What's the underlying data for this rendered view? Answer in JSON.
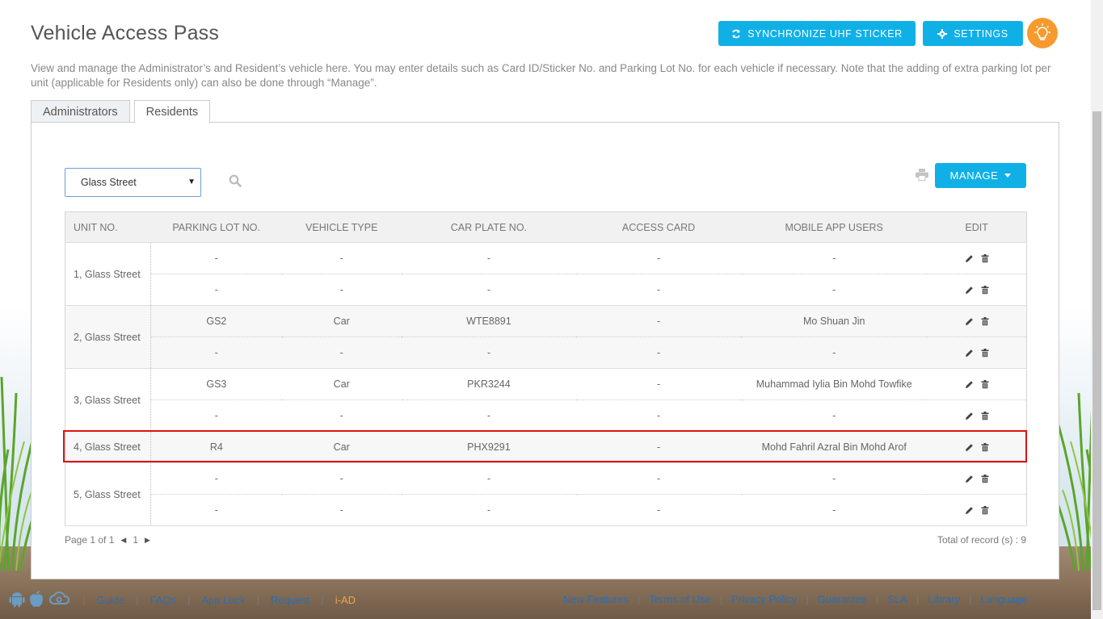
{
  "page": {
    "title": "Vehicle Access Pass",
    "description": "View and manage the Administrator’s and Resident’s vehicle here. You may enter details such as Card ID/Sticker No. and Parking Lot No. for each vehicle if necessary. Note that the adding of extra parking lot per unit (applicable for Residents only) can also be done through “Manage”."
  },
  "toolbar": {
    "sync_label": "SYNCHRONIZE UHF STICKER",
    "settings_label": "SETTINGS",
    "bulb_icon": "lightbulb-icon"
  },
  "tabs": [
    {
      "label": "Administrators",
      "active": false
    },
    {
      "label": "Residents",
      "active": true
    }
  ],
  "filter": {
    "selected_street": "Glass Street",
    "manage_label": "MANAGE"
  },
  "table": {
    "headers": [
      "UNIT NO.",
      "PARKING LOT NO.",
      "VEHICLE TYPE",
      "CAR PLATE NO.",
      "ACCESS CARD",
      "MOBILE APP USERS",
      "EDIT"
    ],
    "units": [
      {
        "unit": "1, Glass Street",
        "rows": [
          {
            "lot": "-",
            "type": "-",
            "plate": "-",
            "card": "-",
            "user": "-"
          },
          {
            "lot": "-",
            "type": "-",
            "plate": "-",
            "card": "-",
            "user": "-"
          }
        ]
      },
      {
        "unit": "2, Glass Street",
        "rows": [
          {
            "lot": "GS2",
            "type": "Car",
            "plate": "WTE8891",
            "card": "-",
            "user": "Mo Shuan Jin"
          },
          {
            "lot": "-",
            "type": "-",
            "plate": "-",
            "card": "-",
            "user": "-"
          }
        ]
      },
      {
        "unit": "3, Glass Street",
        "rows": [
          {
            "lot": "GS3",
            "type": "Car",
            "plate": "PKR3244",
            "card": "-",
            "user": "Muhammad Iylia Bin Mohd Towfike"
          },
          {
            "lot": "-",
            "type": "-",
            "plate": "-",
            "card": "-",
            "user": "-"
          }
        ]
      },
      {
        "unit": "4, Glass Street",
        "rows": [
          {
            "lot": "R4",
            "type": "Car",
            "plate": "PHX9291",
            "card": "-",
            "user": "Mohd Fahril Azral Bin Mohd Arof"
          }
        ]
      },
      {
        "unit": "5, Glass Street",
        "rows": [
          {
            "lot": "-",
            "type": "-",
            "plate": "-",
            "card": "-",
            "user": "-"
          },
          {
            "lot": "-",
            "type": "-",
            "plate": "-",
            "card": "-",
            "user": "-"
          }
        ]
      }
    ]
  },
  "pagination": {
    "page_text": "Page 1 of 1",
    "current": "1",
    "total_text": "Total of record (s) : 9"
  },
  "footer": {
    "left_links": [
      "Guide",
      "FAQs",
      "App Lock",
      "Request",
      "i-AD"
    ],
    "right_links": [
      "New Features",
      "Terms of Use",
      "Privacy Policy",
      "Guarantee",
      "SLA",
      "Library",
      "Language"
    ]
  },
  "colors": {
    "accent": "#10b0e6",
    "bulb": "#f79a2e",
    "highlight": "#e01010",
    "link": "#2a6fb0"
  }
}
